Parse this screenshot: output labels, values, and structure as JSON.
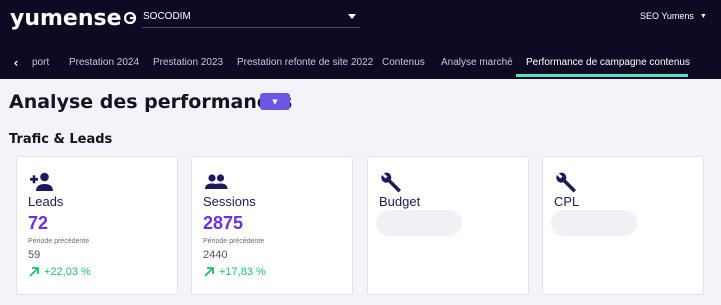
{
  "app": {
    "logo_text": "yumense",
    "project_selector": {
      "value": "SOCODIM"
    },
    "account_label": "SEO Yumens"
  },
  "tabs": [
    {
      "label": "port"
    },
    {
      "label": "Prestation 2024"
    },
    {
      "label": "Prestation 2023"
    },
    {
      "label": "Prestation refonte de site 2022"
    },
    {
      "label": "Contenus"
    },
    {
      "label": "Analyse marché"
    },
    {
      "label": "Performance de campagne contenus",
      "active": true
    }
  ],
  "page": {
    "title": "Analyse des performances",
    "section_title": "Trafic & Leads"
  },
  "cards": [
    {
      "icon": "add-user-icon",
      "label": "Leads",
      "value": "72",
      "previous_label": "Période précédente",
      "previous_value": "59",
      "trend": "+22,03 %"
    },
    {
      "icon": "users-icon",
      "label": "Sessions",
      "value": "2875",
      "previous_label": "Période précédente",
      "previous_value": "2440",
      "trend": "+17,83 %"
    },
    {
      "icon": "wrench-icon",
      "label": "Budget"
    },
    {
      "icon": "wrench-icon",
      "label": "CPL"
    }
  ],
  "colors": {
    "header_bg": "#0d0b24",
    "accent": "#6a2fe0",
    "tab_active_underline": "#5ee0c4",
    "trend_positive": "#1fbf6b",
    "button_bg": "#6b56e6"
  }
}
